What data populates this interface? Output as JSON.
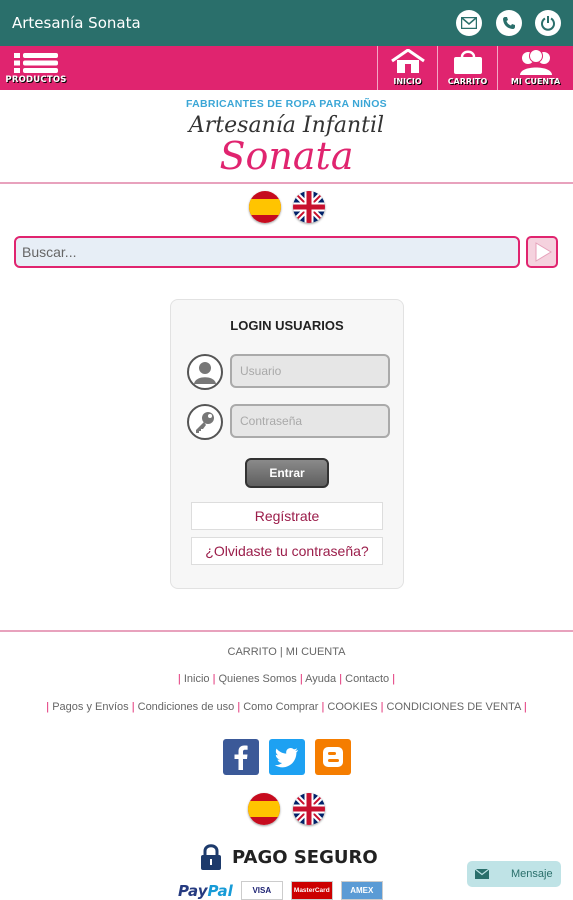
{
  "app": {
    "title": "Artesanía Sonata"
  },
  "colors": {
    "appbar": "#2a6f6b",
    "accent": "#e0246f",
    "tagline": "#3aa6d6",
    "link": "#9b1d4a"
  },
  "nav": {
    "products_label": "PRODUCTOS",
    "home_label": "INICIO",
    "cart_label": "CARRITO",
    "account_label": "MI CUENTA"
  },
  "brand": {
    "tagline": "FABRICANTES DE ROPA PARA NIÑOS",
    "line1": "Artesanía Infantil",
    "line2": "Sonata"
  },
  "search": {
    "placeholder": "Buscar..."
  },
  "login": {
    "title": "LOGIN USUARIOS",
    "username_placeholder": "Usuario",
    "password_placeholder": "Contraseña",
    "submit_label": "Entrar",
    "register_label": "Regístrate",
    "forgot_label": "¿Olvidaste tu contraseña?"
  },
  "footer": {
    "row1": [
      "CARRITO",
      "MI CUENTA"
    ],
    "row2": [
      "Inicio",
      "Quienes Somos",
      "Ayuda",
      "Contacto"
    ],
    "row3": [
      "Pagos y Envíos",
      "Condiciones de uso",
      "Como Comprar",
      "COOKIES",
      "CONDICIONES DE VENTA"
    ],
    "secure_label": "PAGO SEGURO",
    "paypal_a": "Pay",
    "paypal_b": "Pal",
    "visa_label": "VISA",
    "mastercard_label": "MasterCard",
    "amex_label": "AMEX"
  },
  "message_button": {
    "label": "Mensaje"
  }
}
